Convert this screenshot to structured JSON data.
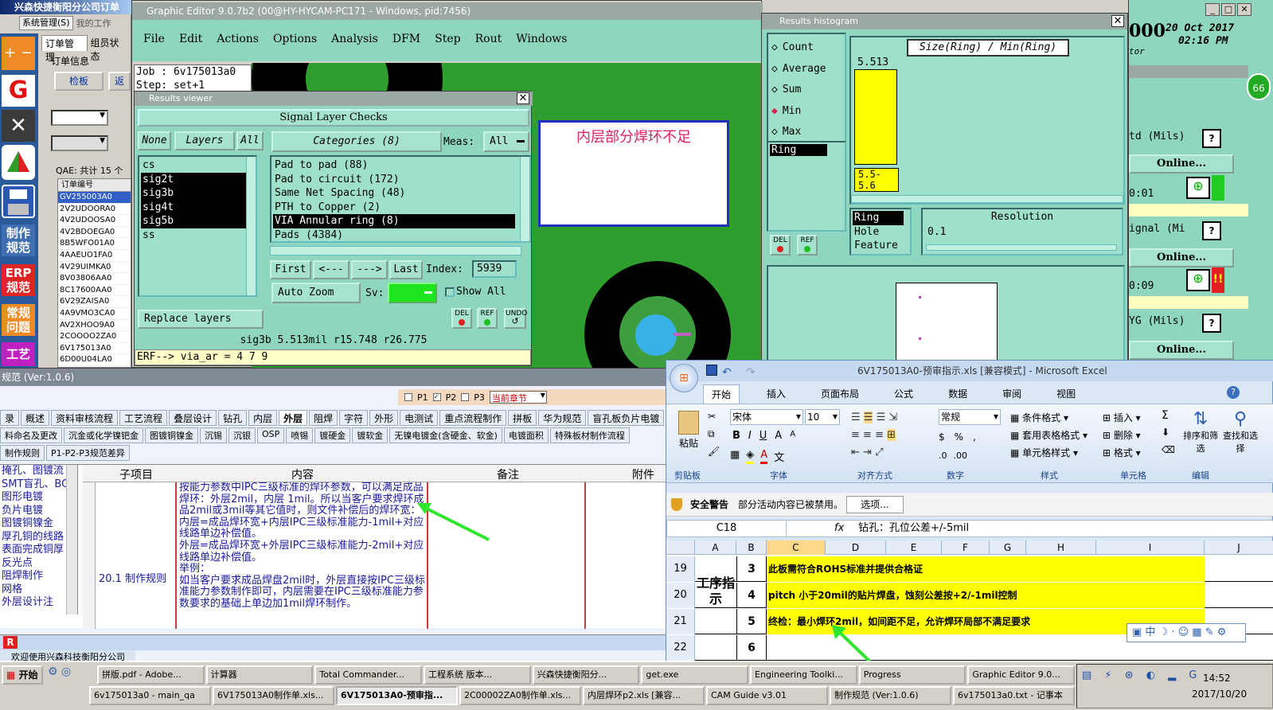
{
  "left_app": {
    "title": "兴森快捷衡阳分公司订单",
    "menu": [
      "系统管理(S)",
      "我的工作"
    ],
    "tabs": [
      "订单管理",
      "组员状态"
    ],
    "order_info_label": "订单信息",
    "check_btn": "检板",
    "qae_label": "QAE: 共计 15 个",
    "col_order": "订单编号",
    "orders": [
      "GV255003A0",
      "2V2UDOORA0",
      "4V2UDOOSA0",
      "4V2BDOEGA0",
      "8B5WFO01A0",
      "4AAEUO1FA0",
      "4V29UIMKA0",
      "8V03806AA0",
      "8C17600AA0",
      "6V29ZAISA0",
      "4A9VMO3CA0",
      "AV2XHOO9A0",
      "2COOOO2ZA0",
      "6V175013A0",
      "6D00U04LA0"
    ],
    "side_labels": [
      "制作规范",
      "ERP规范",
      "常规问题",
      "工艺"
    ]
  },
  "cam": {
    "title": "Graphic Editor 9.0.7b2 (00@HY-HYCAM-PC171 - Windows, pid:7456)",
    "menu": [
      "File",
      "Edit",
      "Actions",
      "Options",
      "Analysis",
      "DFM",
      "Step",
      "Rout",
      "Windows"
    ],
    "job": "Job : 6v175013a0",
    "step": "Step: set+1",
    "annotation": "内层部分焊环不足"
  },
  "viewer": {
    "title": "Results viewer",
    "header": "Signal Layer Checks",
    "none_btn": "None",
    "layers_btn": "Layers",
    "all_btn": "All",
    "categories_btn": "Categories (8)",
    "meas_label": "Meas:",
    "meas_value": "All",
    "layers": [
      {
        "name": "cs",
        "sel": false
      },
      {
        "name": "sig2t",
        "sel": true
      },
      {
        "name": "sig3b",
        "sel": true
      },
      {
        "name": "sig4t",
        "sel": true
      },
      {
        "name": "sig5b",
        "sel": true
      },
      {
        "name": "ss",
        "sel": false
      }
    ],
    "categories": [
      {
        "name": "Pad to pad (88)",
        "sel": false
      },
      {
        "name": "Pad to circuit (172)",
        "sel": false
      },
      {
        "name": "Same Net Spacing (48)",
        "sel": false
      },
      {
        "name": "PTH to Copper (2)",
        "sel": false
      },
      {
        "name": "VIA Annular ring (8)",
        "sel": true
      },
      {
        "name": "Pads (4384)",
        "sel": false
      }
    ],
    "first": "First",
    "prev": "<---",
    "next": "--->",
    "last": "Last",
    "index_label": "Index:",
    "index_value": "5939",
    "auto_zoom": "Auto Zoom",
    "sv_label": "Sv:",
    "show_all": "Show All",
    "replace_layers": "Replace layers",
    "del": "DEL",
    "ref": "REF",
    "undo": "UNDO",
    "status": "sig3b  5.513mil   r15.748   r26.775",
    "erf": "ERF--> via_ar = 4 7 9"
  },
  "histogram": {
    "title": "Results histogram",
    "options": [
      {
        "label": "Count",
        "sel": false
      },
      {
        "label": "Average",
        "sel": false
      },
      {
        "label": "Sum",
        "sel": false
      },
      {
        "label": "Min",
        "sel": true
      },
      {
        "label": "Max",
        "sel": false
      }
    ],
    "formula": "Size(Ring) / Min(Ring)",
    "bar_value": "5.513",
    "bin_label": "5.5-5.6",
    "list": [
      "Ring"
    ],
    "list2": [
      "Ring",
      "Hole",
      "Feature"
    ],
    "resolution_label": "Resolution",
    "resolution_value": "0.1",
    "del": "DEL",
    "ref": "REF"
  },
  "right_panel": {
    "big": "000",
    "date": "20 Oct 2017",
    "time": "02:16 PM",
    "tor": "tor",
    "badge": "66",
    "rows": [
      {
        "label": "td (Mils)",
        "btn": "Online...",
        "time": "0:01"
      },
      {
        "label": "ignal (Mi",
        "btn": "Online...",
        "time": "0:09"
      },
      {
        "label": "YG (Mils)",
        "btn": "Online..."
      }
    ],
    "help": "?"
  },
  "spec": {
    "title": "规范 (Ver:1.0.6)",
    "p1": "P1",
    "p2": "P2",
    "p3": "P3",
    "chapter": "当前章节",
    "tabs1": [
      "录",
      "概述",
      "资料审核流程",
      "工艺流程",
      "叠层设计",
      "钻孔",
      "内层",
      "外层",
      "阻焊",
      "字符",
      "外形",
      "电测试",
      "重点流程制作",
      "拼板",
      "华为规范",
      "盲孔板负片电镀"
    ],
    "tabs2": [
      "料命名及更改",
      "沉金或化学镍钯金",
      "图镀铜镍金",
      "沉锡",
      "沉银",
      "OSP",
      "喷锡",
      "镀硬金",
      "镀软金",
      "无镍电镀金(含硬金、软金)",
      "电镀面积",
      "特殊板材制作流程"
    ],
    "tabs3": [
      "制作规则",
      "P1-P2-P3规范差异"
    ],
    "left_list": [
      "掩孔、图镀流",
      "SMT盲孔、BG",
      "图形电镀",
      "负片电镀",
      "图镀铜镍金",
      "厚孔铜的线路",
      "表面完成铜厚",
      "反光点",
      "阻焊制作",
      "网格",
      "外层设计注"
    ],
    "col_sub": "子项目",
    "col_content": "内容",
    "col_note": "备注",
    "col_attach": "附件",
    "sub_item": "20.1 制作规则",
    "content": [
      "按能力参数中IPC三级标准的焊环参数，可以满足成品焊环：外层2mil，内层 1mil。所以当客户要求焊环成品2mil或3mil等其它值时，则文件补偿后的焊环宽：",
      "内层=成品焊环宽+内层IPC三级标准能力-1mil+对应线路单边补偿值。",
      "外层=成品焊环宽+外层IPC三级标准能力-2mil+对应线路单边补偿值。",
      "举例：",
      "如当客户要求成品焊盘2mil时，外层直接按IPC三级标准能力参数制作即可，内层需要在IPC三级标准能力参数要求的基础上单边加1mil焊环制作。"
    ],
    "footer": "欢迎使用兴森科技衡阳分公司"
  },
  "excel": {
    "title": "6V175013A0-预审指示.xls [兼容模式] - Microsoft Excel",
    "tabs": [
      "开始",
      "插入",
      "页面布局",
      "公式",
      "数据",
      "审阅",
      "视图"
    ],
    "font": "宋体",
    "size": "10",
    "numfmt": "常规",
    "paste": "粘贴",
    "groups": [
      "剪贴板",
      "字体",
      "对齐方式",
      "数字",
      "样式",
      "单元格",
      "编辑"
    ],
    "style_items": [
      "条件格式",
      "套用表格格式",
      "单元格样式"
    ],
    "cell_items": [
      "插入",
      "删除",
      "格式"
    ],
    "edit_items": [
      "排序和筛选",
      "查找和选择"
    ],
    "sec_warn": "安全警告",
    "sec_msg": "部分活动内容已被禁用。",
    "sec_btn": "选项...",
    "namebox": "C18",
    "fx": "fx",
    "formula": "钻孔：孔位公差+/-5mil",
    "cols": [
      "A",
      "B",
      "C",
      "D",
      "E",
      "F",
      "G",
      "H",
      "I",
      "J"
    ],
    "rows": [
      {
        "num": "19",
        "b": "3",
        "text": "此板需符合ROHS标准并提供合格证"
      },
      {
        "num": "20",
        "b": "4",
        "text": "pitch 小于20mil的贴片焊盘，蚀刻公差按+2/-1mil控制"
      },
      {
        "num": "21",
        "b": "5",
        "text": "终检：最小焊环2mil，如间距不足，允许焊环局部不满足要求"
      },
      {
        "num": "22",
        "b": "6",
        "text": ""
      }
    ],
    "process_label": "工序指示",
    "ime": "中"
  },
  "taskbar": {
    "start": "开始",
    "row1": [
      "拼版.pdf - Adobe...",
      "计算器",
      "Total Commander...",
      "工程系统  版本...",
      "兴森快捷衡阳分...",
      "get.exe",
      "Engineering Toolki...",
      "Progress",
      "Graphic Editor 9.0..."
    ],
    "row2": [
      "6v175013a0 - main_qa",
      "6V175013A0制作单.xls...",
      "6V175013A0-预审指...",
      "2C00002ZA0制作单.xls...",
      "内层焊环p2.xls [兼容...",
      "CAM Guide v3.01",
      "制作规范 (Ver:1.0.6)",
      "6v175013a0.txt - 记事本"
    ],
    "clock": "14:52",
    "date": "2017/10/20"
  },
  "colors": {
    "cam_green": "#2e9e2e",
    "teal": "#8fd6c0",
    "yellow": "#ffff00",
    "excel_blue": "#c5d9f1"
  }
}
